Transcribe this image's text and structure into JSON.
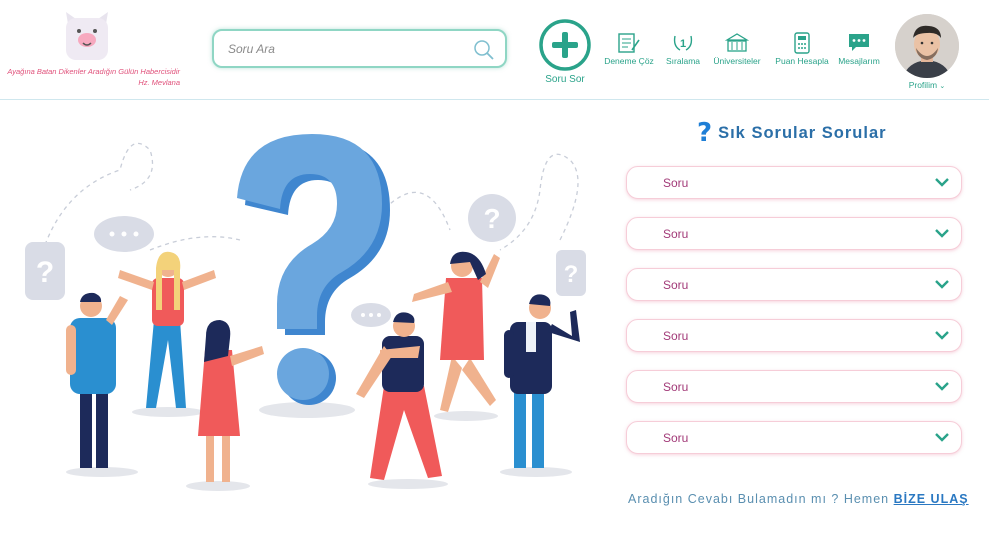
{
  "header": {
    "logo_icon": "llama-logo-icon",
    "tagline_line1": "Ayağına Batan Dikenler Aradığın Gülün Habercisidir",
    "tagline_line2": "Hz. Mevlana",
    "search": {
      "placeholder": "Soru Ara",
      "icon": "search-icon"
    },
    "ask_button": {
      "label": "Soru Sor",
      "icon": "plus-circle-icon"
    },
    "nav": [
      {
        "label": "Deneme Çöz",
        "icon": "exam-icon"
      },
      {
        "label": "Sıralama",
        "icon": "ranking-icon"
      },
      {
        "label": "Üniversiteler",
        "icon": "university-icon"
      },
      {
        "label": "Puan Hesapla",
        "icon": "calculator-icon"
      },
      {
        "label": "Mesajlarım",
        "icon": "message-icon"
      }
    ],
    "profile": {
      "label": "Profilim",
      "icon": "chevron-down-icon"
    }
  },
  "faq": {
    "title": "Sık Sorular Sorular",
    "title_icon": "question-mark-icon",
    "items": [
      {
        "label": "Soru"
      },
      {
        "label": "Soru"
      },
      {
        "label": "Soru"
      },
      {
        "label": "Soru"
      },
      {
        "label": "Soru"
      },
      {
        "label": "Soru"
      }
    ]
  },
  "contact": {
    "text": "Aradığın Cevabı Bulamadın mı ? Hemen",
    "link": "BİZE ULAŞ"
  },
  "colors": {
    "accent_green": "#2aa38a",
    "title_blue": "#2b6fa8",
    "faq_border": "#f6cdd8",
    "faq_text": "#a23a78",
    "tagline_pink": "#e0507a"
  }
}
